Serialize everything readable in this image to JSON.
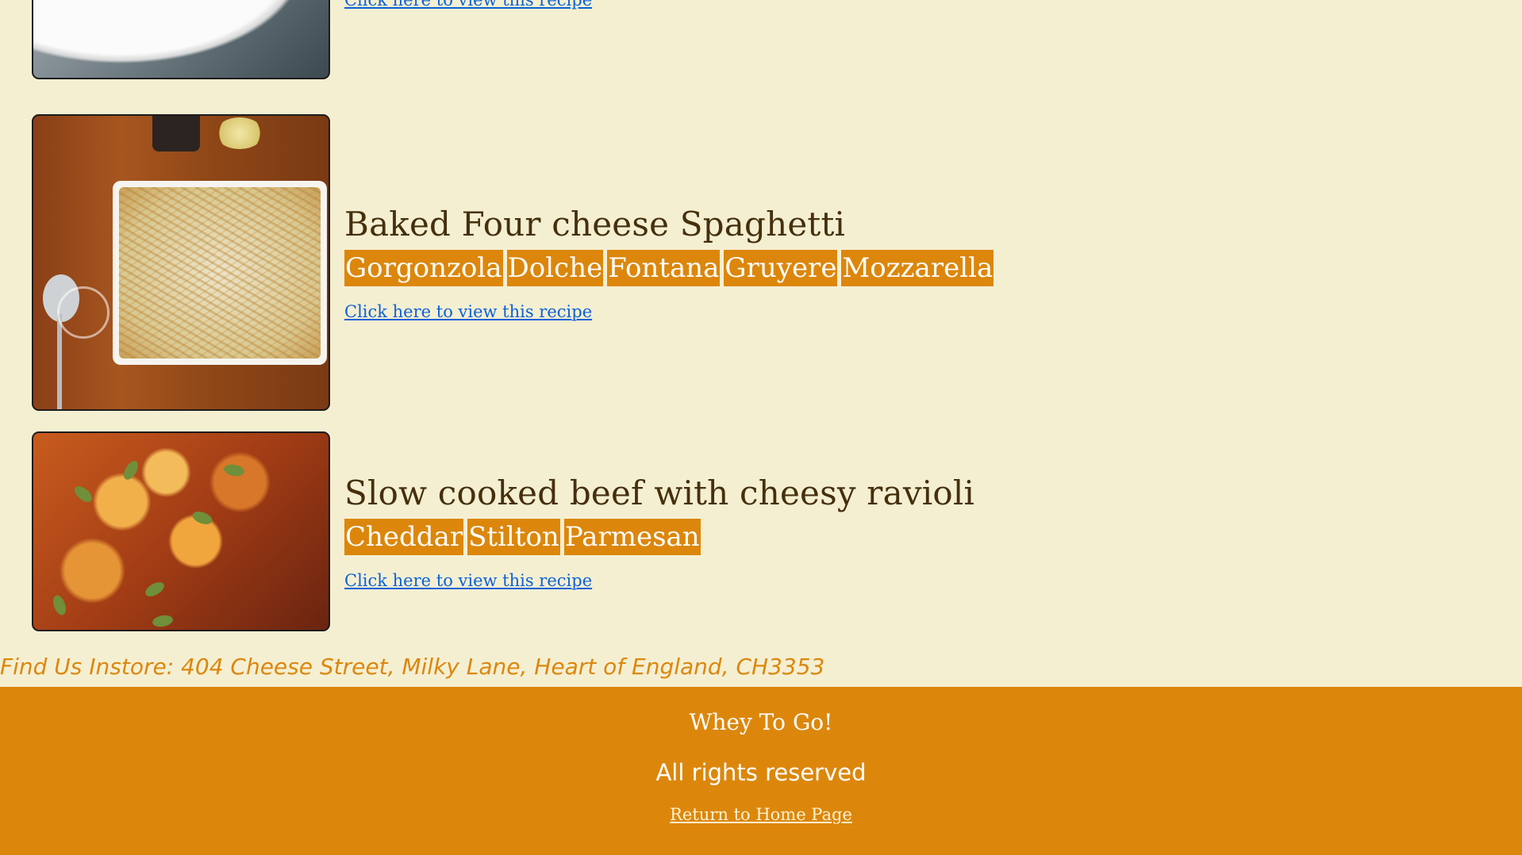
{
  "previous_recipe": {
    "link_label": "Click here to view this recipe"
  },
  "recipes": [
    {
      "title": "Baked Four cheese Spaghetti",
      "tags": [
        "Gorgonzola",
        "Dolche",
        "Fontana",
        "Gruyere",
        "Mozzarella"
      ],
      "link_label": "Click here to view this recipe"
    },
    {
      "title": "Slow cooked beef with cheesy ravioli",
      "tags": [
        "Cheddar",
        "Stilton",
        "Parmesan"
      ],
      "link_label": "Click here to view this recipe"
    }
  ],
  "store": {
    "address": "Find Us Instore: 404 Cheese Street, Milky Lane, Heart of England, CH3353"
  },
  "footer": {
    "brand": "Whey To Go!",
    "rights": "All rights reserved",
    "home_link": "Return to Home Page"
  },
  "colors": {
    "background": "#f5efd2",
    "accent": "#dc870c",
    "title_text": "#45300c",
    "link": "#0b62d6"
  }
}
